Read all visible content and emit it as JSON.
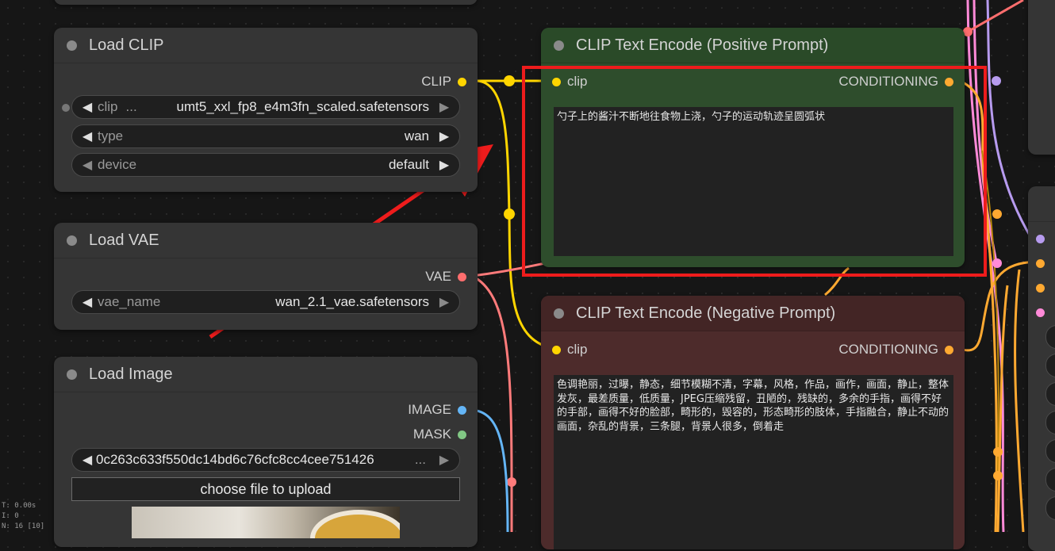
{
  "nodes": {
    "load_clip": {
      "title": "Load CLIP",
      "output_label": "CLIP",
      "widgets": [
        {
          "name": "clip",
          "value": "umt5_xxl_fp8_e4m3fn_scaled.safetensors"
        },
        {
          "name": "type",
          "value": "wan"
        },
        {
          "name": "device",
          "value": "default"
        }
      ],
      "clip_ellipsis": "..."
    },
    "load_vae": {
      "title": "Load VAE",
      "output_label": "VAE",
      "widgets": [
        {
          "name": "vae_name",
          "value": "wan_2.1_vae.safetensors"
        }
      ]
    },
    "load_image": {
      "title": "Load Image",
      "outputs": [
        "IMAGE",
        "MASK"
      ],
      "image_value": "0c263c633f550dc14bd6c76cfc8cc4cee751426",
      "image_ellipsis": "...",
      "upload_label": "choose file to upload"
    },
    "positive": {
      "title": "CLIP Text Encode (Positive Prompt)",
      "input_label": "clip",
      "output_label": "CONDITIONING",
      "text": "勺子上的酱汁不断地往食物上浇，勺子的运动轨迹呈圆弧状"
    },
    "negative": {
      "title": "CLIP Text Encode (Negative Prompt)",
      "input_label": "clip",
      "output_label": "CONDITIONING",
      "text": "色调艳丽，过曝，静态，细节模糊不清，字幕，风格，作品，画作，画面，静止，整体发灰，最差质量，低质量，JPEG压缩残留，丑陋的，残缺的，多余的手指，画得不好的手部，画得不好的脸部，畸形的，毁容的，形态畸形的肢体，手指融合，静止不动的画面，杂乱的背景，三条腿，背景人很多，倒着走"
    }
  },
  "stats": {
    "t": "T: 0.00s",
    "i": "I: 0",
    "n": "N: 16 [10]"
  },
  "colors": {
    "clip_port": "#ffd500",
    "vae_port": "#ff6e6e",
    "image_port": "#64b5f6",
    "mask_port": "#81c784",
    "conditioning_port": "#ffa931",
    "positive_bg": "#2e4d2c",
    "negative_bg": "#4d2b2b",
    "annotation": "#ee1c1c"
  }
}
